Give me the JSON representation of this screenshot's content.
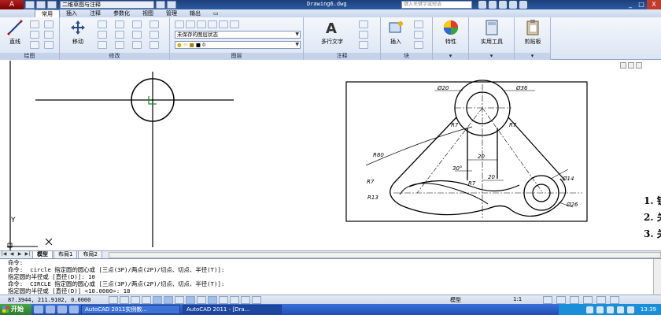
{
  "titlebar": {
    "logo_glyph": "A",
    "workspace": "二维草图与注释",
    "document": "Drawing6.dwg",
    "search_placeholder": "键入关键字或短语",
    "win_min": "_",
    "win_max": "□",
    "win_close": "X"
  },
  "tabs": [
    "常用",
    "插入",
    "注释",
    "参数化",
    "视图",
    "管理",
    "输出",
    "▭"
  ],
  "ribbon": {
    "draw": {
      "title": "绘图",
      "line_label": "直线"
    },
    "modify": {
      "title": "修改",
      "move_label": "移动"
    },
    "layers": {
      "title": "图层",
      "state": "未保存的图层状态",
      "current": "0"
    },
    "annotation": {
      "title": "注释",
      "mtext_label": "多行文字"
    },
    "block": {
      "title": "块",
      "insert_label": "插入"
    },
    "properties_label": "特性",
    "utilities_label": "实用工具",
    "clipboard_label": "剪贴板"
  },
  "drawing": {
    "dims": {
      "d20": "Ø20",
      "d36": "Ø36",
      "r7a": "R7",
      "r7b": "R7",
      "r7c": "R7",
      "r7d": "R7",
      "r80": "R80",
      "twenty_a": "20",
      "twenty_b": "20",
      "deg30": "30°",
      "r13": "R13",
      "d14": "Ø14",
      "d26": "Ø26"
    },
    "ucs_label": "Y"
  },
  "side_text": [
    "1. 锁",
    "2. 关",
    "3. 关"
  ],
  "layout_tabs": [
    "模型",
    "布局1",
    "布局2"
  ],
  "command_lines": [
    "命令:",
    "命令:  circle 指定圆的圆心或 [三点(3P)/两点(2P)/切点、切点、半径(T)]:",
    "指定圆的半径或 [直径(D)]: 10",
    "命令:  CIRCLE 指定圆的圆心或 [三点(3P)/两点(2P)/切点、切点、半径(T)]:",
    "指定圆的半径或 [直径(D)] <10.0000>: 18"
  ],
  "status": {
    "coords": "87.3944,  211.9102,  0.0000",
    "model": "模型",
    "scale": "1:1"
  },
  "taskbar": {
    "start": "开始",
    "tasks": [
      "AutoCAD 2011实例教...",
      "AutoCAD 2011 - [Dra..."
    ],
    "clock": "13:39"
  }
}
